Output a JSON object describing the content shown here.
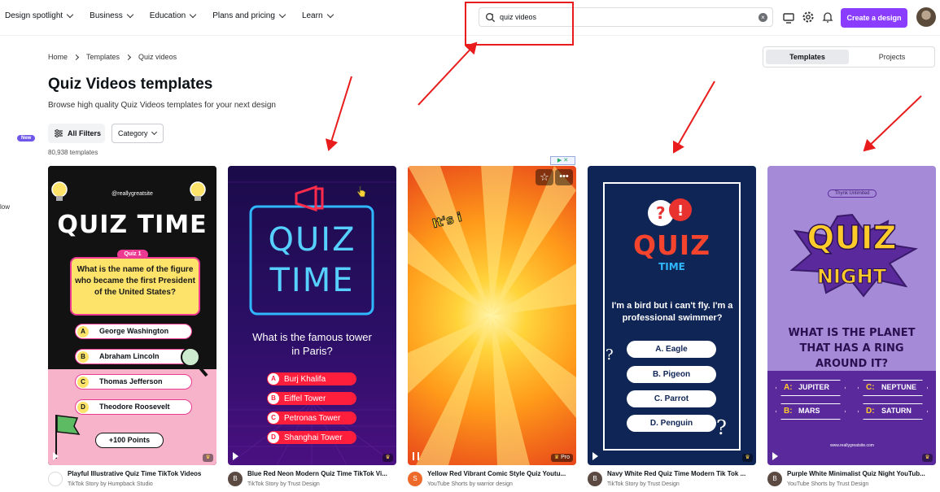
{
  "nav": {
    "items": [
      "Design spotlight",
      "Business",
      "Education",
      "Plans and pricing",
      "Learn"
    ]
  },
  "search": {
    "value": "quiz videos"
  },
  "header": {
    "create_label": "Create a design"
  },
  "sidebar": {
    "new_badge": "New",
    "partial_text": "low"
  },
  "breadcrumb": {
    "items": [
      "Home",
      "Templates",
      "Quiz videos"
    ]
  },
  "page": {
    "title": "Quiz Videos templates",
    "subtitle": "Browse high quality Quiz Videos templates for your next design",
    "filters_label": "All Filters",
    "category_label": "Category",
    "count": "80,938 templates"
  },
  "toggle": {
    "templates": "Templates",
    "projects": "Projects"
  },
  "cards": [
    {
      "title": "Playful Illustrative Quiz Time TikTok Videos",
      "sub": "TikTok Story by Humpback Studio",
      "avatar": "",
      "handle": "@reallygreatsite",
      "heading": "QUIZ TIME",
      "tag": "Quiz 1",
      "question": "What is the name of the figure who became the first President of the United States?",
      "options": [
        {
          "letter": "A",
          "text": "George Washington"
        },
        {
          "letter": "B",
          "text": "Abraham Lincoln"
        },
        {
          "letter": "C",
          "text": "Thomas Jefferson"
        },
        {
          "letter": "D",
          "text": "Theodore Roosevelt"
        }
      ],
      "points": "+100 Points"
    },
    {
      "title": "Blue Red Neon Modern Quiz Time TikTok Vi...",
      "sub": "TikTok Story by Trust Design",
      "avatar": "B",
      "heading1": "QUIZ",
      "heading2": "TIME",
      "question": "What is the famous tower in Paris?",
      "options": [
        {
          "letter": "A",
          "text": "Burj Khalifa"
        },
        {
          "letter": "B",
          "text": "Eiffel Tower"
        },
        {
          "letter": "C",
          "text": "Petronas Tower"
        },
        {
          "letter": "D",
          "text": "Shanghai Tower"
        }
      ]
    },
    {
      "title": "Yellow Red Vibrant Comic Style Quiz Youtu...",
      "sub": "YouTube Shorts by warrior design",
      "avatar": "S",
      "burst": "It's i",
      "pro": "Pro"
    },
    {
      "title": "Navy White Red Quiz Time Modern Tik Tok ...",
      "sub": "TikTok Story by Trust Design",
      "avatar": "B",
      "heading1": "QUIZ",
      "heading2": "TIME",
      "question": "I'm a bird but i can't fly. I'm a professional swimmer?",
      "options": [
        "A. Eagle",
        "B. Pigeon",
        "C. Parrot",
        "D. Penguin"
      ]
    },
    {
      "title": "Purple White Minimalist Quiz Night YouTub...",
      "sub": "YouTube Shorts by Trust Design",
      "avatar": "B",
      "brand": "Thynk Unlimited",
      "heading1": "QUIZ",
      "heading2": "NIGHT",
      "question": "WHAT IS THE PLANET THAT HAS A RING AROUND IT?",
      "options": [
        {
          "letter": "A:",
          "text": "JUPITER"
        },
        {
          "letter": "C:",
          "text": "NEPTUNE"
        },
        {
          "letter": "B:",
          "text": "MARS"
        },
        {
          "letter": "D:",
          "text": "SATURN"
        }
      ],
      "site": "www.reallygreatsite.com"
    }
  ],
  "colors": {
    "accent": "#8b3dff",
    "annotation": "#e81c1c"
  }
}
